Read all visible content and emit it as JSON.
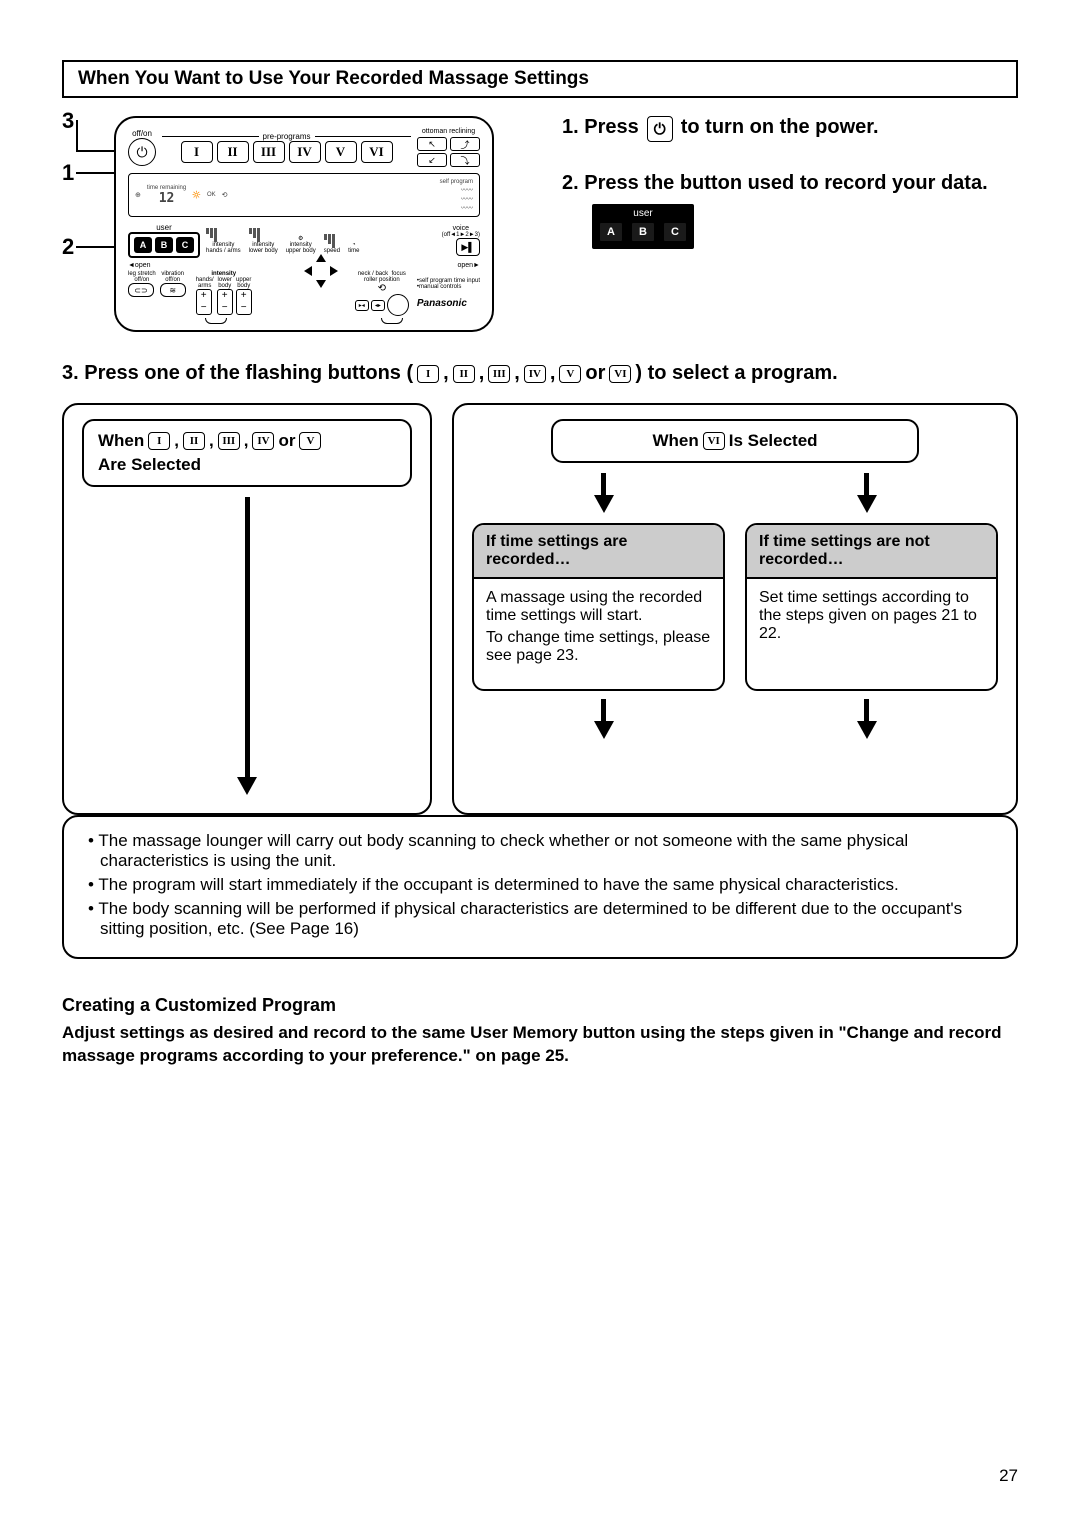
{
  "section_title": "When You Want to Use Your Recorded Massage Settings",
  "callouts": {
    "one": "1",
    "two": "2",
    "three": "3"
  },
  "remote": {
    "off_on": "off/on",
    "pre_programs": "pre-programs",
    "ottoman": "ottoman reclining",
    "time_remaining": "time remaining",
    "self_program": "self program",
    "user": "user",
    "user_a": "A",
    "user_b": "B",
    "user_c": "C",
    "intensity": "intensity",
    "hands_arms": "hands / arms",
    "lower_body": "lower body",
    "intensity2": "intensity",
    "speed": "speed",
    "time": "time",
    "upper_body": "upper body",
    "voice": "voice",
    "voice_sub": "(off◄1►2►3)",
    "open_l": "◄open",
    "open_r": "open►",
    "leg_stretch": "leg stretch",
    "off_on2": "off/on",
    "vibration": "vibration",
    "off_on3": "off/on",
    "hands_arms2": "hands/\narms",
    "lower_body2": "lower\nbody",
    "upper_body2": "upper\nbody",
    "neck_back": "neck / back",
    "roller_position": "roller position",
    "focus": "focus",
    "self_prog_input": "•self program time input",
    "manual_controls": "•manual controls",
    "brand": "Panasonic",
    "ok": "OK",
    "twelve": "12"
  },
  "steps": {
    "s1_pre": "1. Press",
    "s1_post": "to turn on the power.",
    "s2": "2. Press the button used to record your data.",
    "s2_user": "user",
    "s2_a": "A",
    "s2_b": "B",
    "s2_c": "C"
  },
  "step3": {
    "pre": "3. Press one of the flashing buttons (",
    "sep": ",",
    "or": "or",
    "post": ") to select a program."
  },
  "romans": {
    "i": "I",
    "ii": "II",
    "iii": "III",
    "iv": "IV",
    "v": "V",
    "vi": "VI"
  },
  "flow": {
    "when_left_pre": "When",
    "when_left_or": "or",
    "when_left_post": "Are Selected",
    "when_right_pre": "When",
    "when_right_post": "Is Selected",
    "cond1_h": "If time settings are recorded…",
    "cond1_b1": "A massage using the recorded time settings will start.",
    "cond1_b2": "To change time settings, please see page 23.",
    "cond2_h": "If time settings are not recorded…",
    "cond2_b": "Set time settings according to the steps given on pages 21 to 22.",
    "result1": "The massage lounger will carry out body scanning to check whether or not someone with the same physical characteristics is using the unit.",
    "result2": "The program will start immediately if the occupant is determined to have the same physical characteristics.",
    "result3": "The body scanning will be performed if physical characteristics are determined to be different due to the occupant's sitting position, etc. (See Page 16)"
  },
  "custom": {
    "title": "Creating a Customized Program",
    "text": "Adjust settings as desired and record to the same User Memory button using the steps given in \"Change and record massage programs according to your preference.\" on page 25."
  },
  "page_number": "27"
}
